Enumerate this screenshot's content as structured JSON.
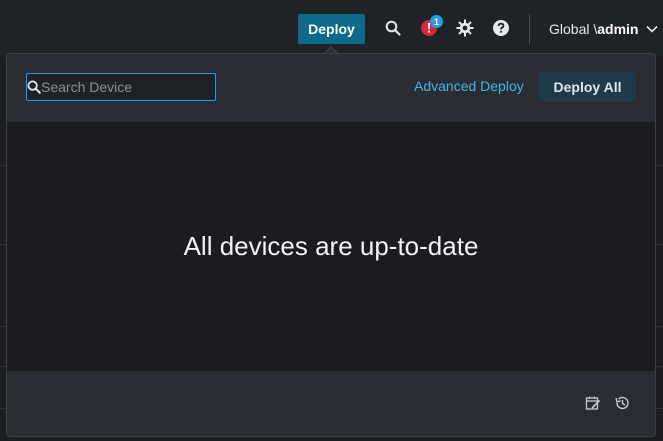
{
  "topbar": {
    "deploy_label": "Deploy",
    "notification_count": "1",
    "domain_prefix": "Global \\ ",
    "user": "admin",
    "icons": [
      "search-icon",
      "alert-icon",
      "gear-icon",
      "help-icon",
      "chevron-down-icon"
    ]
  },
  "panel": {
    "search_placeholder": "Search Device",
    "search_value": "",
    "advanced_deploy_label": "Advanced Deploy",
    "deploy_all_label": "Deploy All",
    "empty_message": "All devices are up-to-date",
    "footer_icons": [
      "deployment-edit-icon",
      "history-icon"
    ]
  },
  "colors": {
    "accent": "#0d6a8a",
    "link": "#3fb6ee",
    "alert": "#d9263c",
    "badge": "#1fa0e0"
  }
}
